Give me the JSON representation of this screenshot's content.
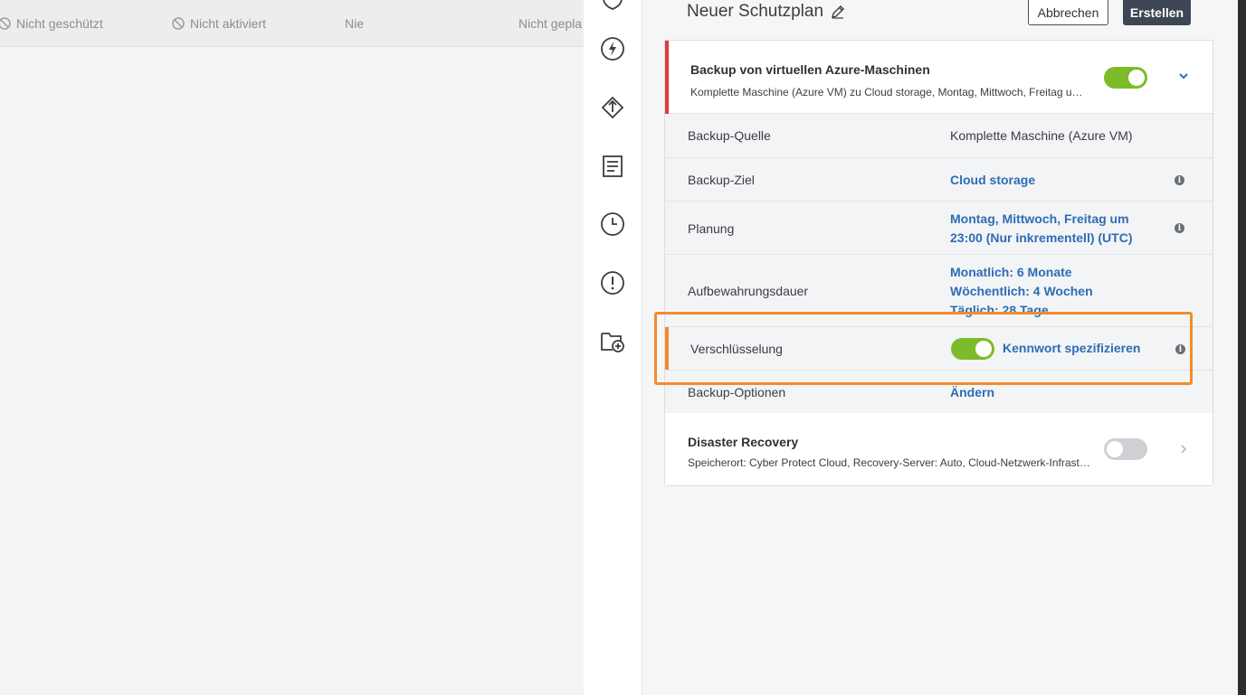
{
  "background_row": {
    "col1": "Nicht geschützt",
    "col2": "Nicht aktiviert",
    "col3": "Nie",
    "col4": "Nicht gepla"
  },
  "plan": {
    "title": "Neuer Schutzplan",
    "cancel_label": "Abbrechen",
    "create_label": "Erstellen"
  },
  "backup_module": {
    "title": "Backup von virtuellen Azure-Maschinen",
    "summary": "Komplette Maschine (Azure VM) zu Cloud storage, Montag, Mittwoch, Freitag u…",
    "enabled": true,
    "rows": {
      "source_label": "Backup-Quelle",
      "source_value": "Komplette Maschine (Azure VM)",
      "target_label": "Backup-Ziel",
      "target_value": "Cloud storage",
      "schedule_label": "Planung",
      "schedule_line1": "Montag, Mittwoch, Freitag um",
      "schedule_line2": "23:00 (Nur inkrementell) (UTC)",
      "retention_label": "Aufbewahrungsdauer",
      "retention_line1": "Monatlich: 6 Monate",
      "retention_line2": "Wöchentlich: 4 Wochen",
      "retention_line3": "Täglich: 28 Tage",
      "encryption_label": "Verschlüsselung",
      "encryption_value": "Kennwort spezifizieren",
      "encryption_enabled": true,
      "options_label": "Backup-Optionen",
      "options_value": "Ändern"
    }
  },
  "disaster_recovery": {
    "title": "Disaster Recovery",
    "summary": "Speicherort: Cyber Protect Cloud, Recovery-Server: Auto, Cloud-Netzwerk-Infrast…",
    "enabled": false
  },
  "colors": {
    "accent_green": "#7cbb2a",
    "link_blue": "#2d6db4",
    "highlight_orange": "#f28c2c",
    "alert_red": "#e03a3a"
  },
  "sidebar_icons": [
    "shield-icon",
    "lightning-icon",
    "upload-icon",
    "report-icon",
    "clock-icon",
    "alert-icon",
    "folder-add-icon"
  ]
}
